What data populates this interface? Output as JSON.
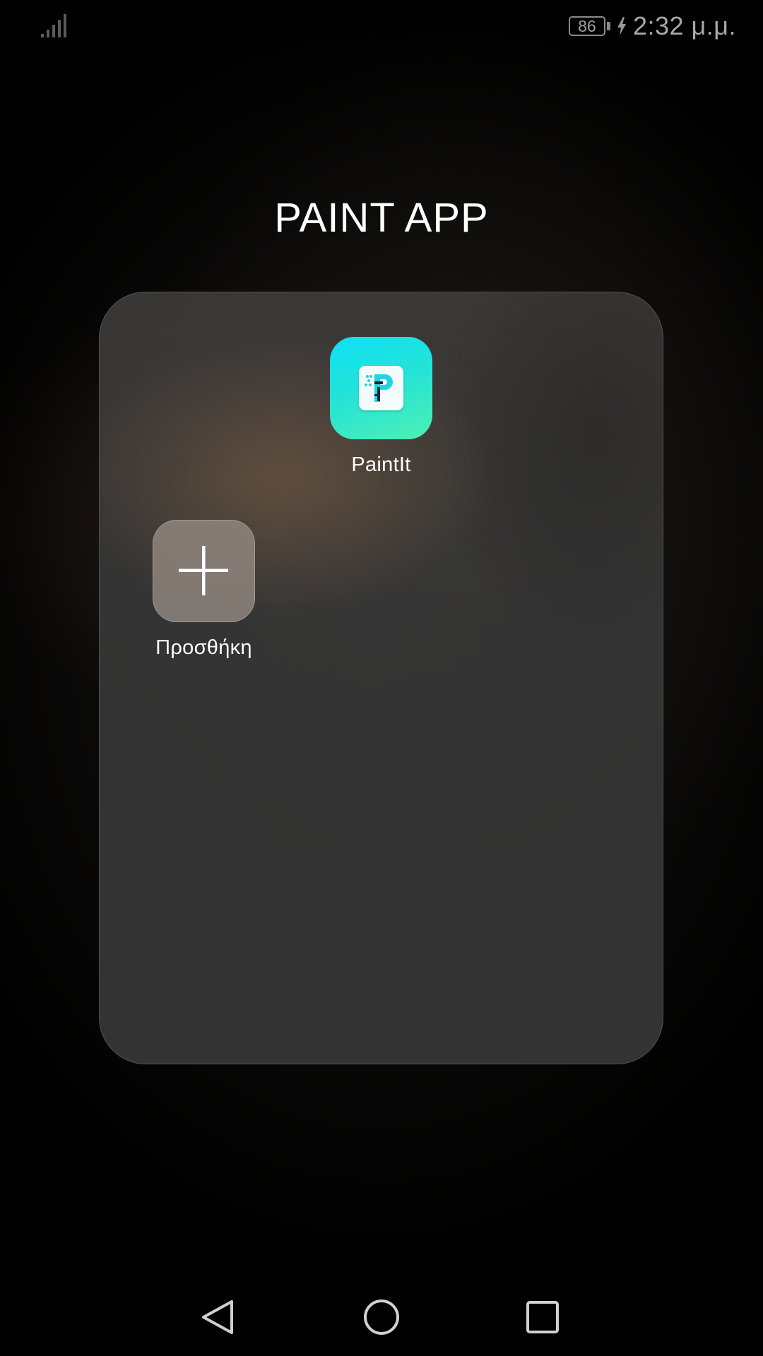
{
  "status_bar": {
    "signal_icon": "signal-bars-icon",
    "battery_level": "86",
    "charging_icon": "lightning-bolt-icon",
    "time": "2:32 μ.μ."
  },
  "folder": {
    "title": "PAINT APP",
    "apps": [
      {
        "label": "PaintIt",
        "icon": "paintit-app-icon",
        "icon_colors": [
          "#0fe0f5",
          "#4ef0b4"
        ]
      },
      {
        "label": "Προσθήκη",
        "icon": "plus-icon"
      }
    ]
  },
  "nav_bar": {
    "back_icon": "back-triangle-icon",
    "home_icon": "home-circle-icon",
    "recents_icon": "recents-square-icon"
  }
}
